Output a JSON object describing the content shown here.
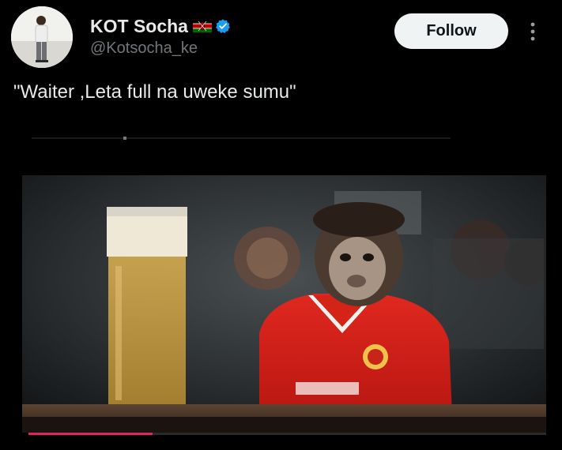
{
  "tweet": {
    "author": {
      "display_name": "KOT Socha",
      "handle": "@Kotsocha_ke",
      "flag_icon": "kenya-flag-icon",
      "verified_icon": "verified-badge-icon",
      "verified_color": "#1d9bf0"
    },
    "follow_label": "Follow",
    "more_icon": "more-dots-icon",
    "text": "\"Waiter ,Leta full na uweke sumu\"",
    "media": {
      "type": "video",
      "progress": 0.24,
      "progress_color": "#e0245e"
    }
  }
}
